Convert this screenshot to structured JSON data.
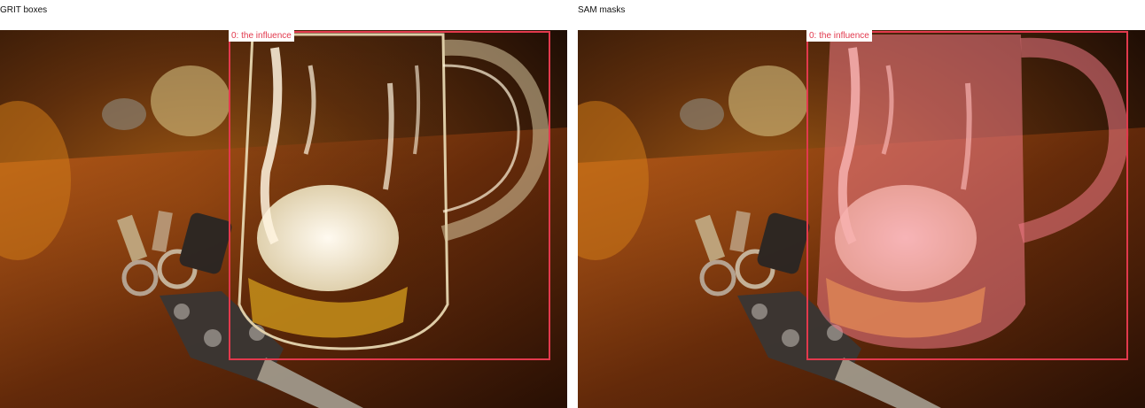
{
  "panels": [
    {
      "title": "GRIT boxes",
      "box_label": "0: the influence"
    },
    {
      "title": "SAM masks",
      "box_label": "0: the influence"
    }
  ],
  "colors": {
    "box_outline": "#e2394d",
    "mask_fill": "#f07a86"
  }
}
